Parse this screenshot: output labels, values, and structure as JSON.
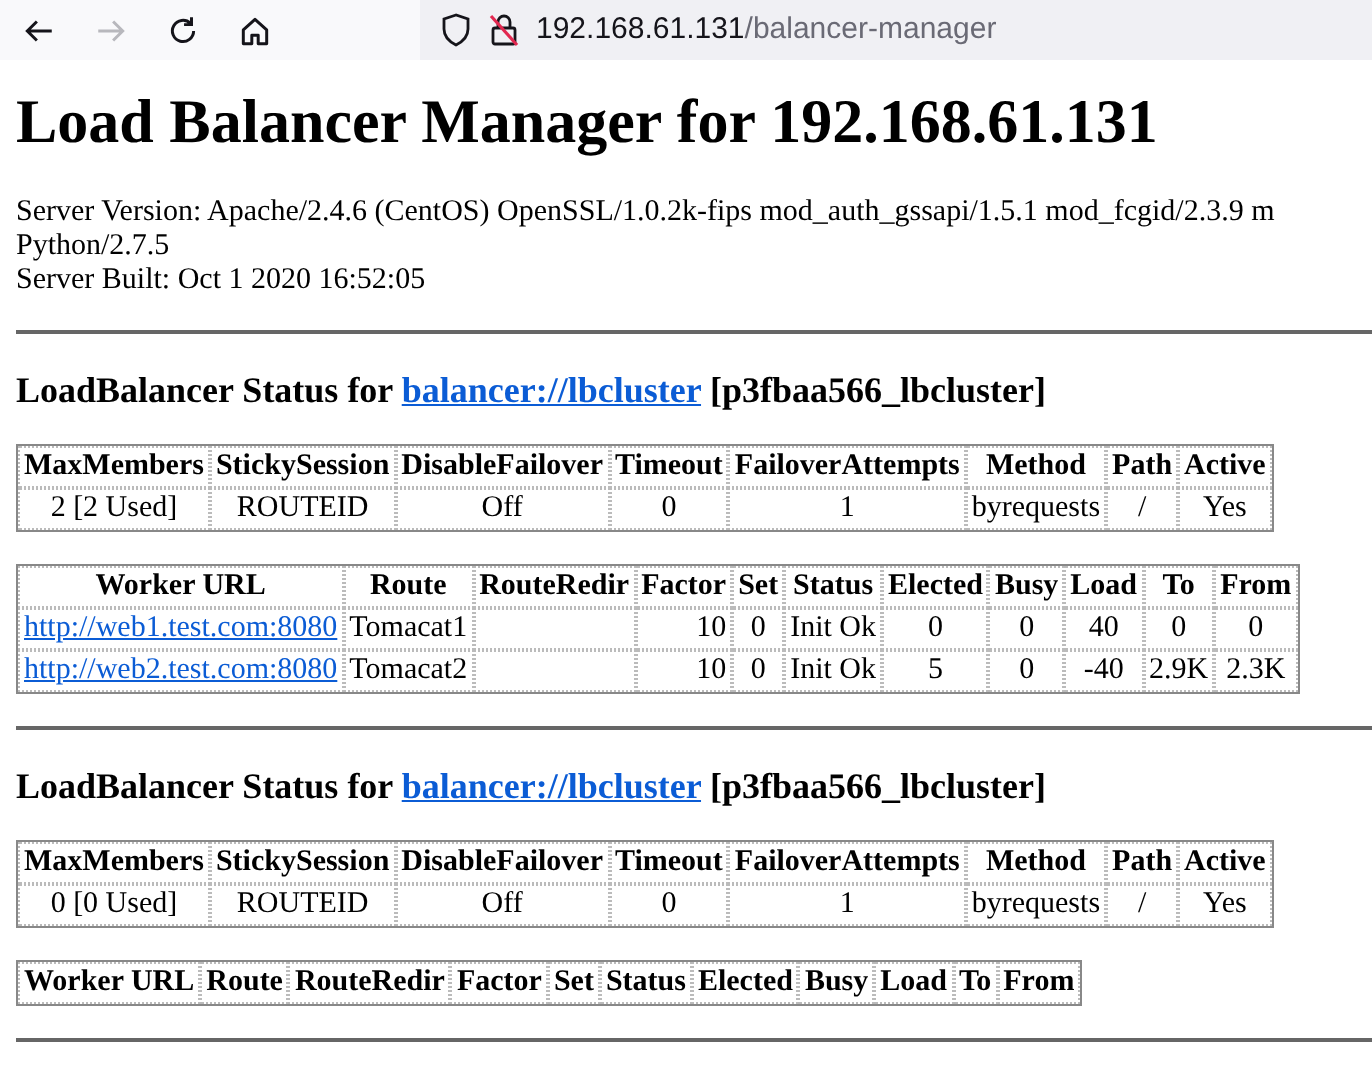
{
  "browser": {
    "forward_disabled": true,
    "url_host": "192.168.61.131",
    "url_path": "/balancer-manager",
    "insecure": true
  },
  "heading": "Load Balancer Manager for 192.168.61.131",
  "server_info": [
    "Server Version: Apache/2.4.6 (CentOS) OpenSSL/1.0.2k-fips mod_auth_gssapi/1.5.1 mod_fcgid/2.3.9 m",
    "Python/2.7.5",
    "Server Built: Oct 1 2020 16:52:05"
  ],
  "sections": [
    {
      "title": "LoadBalancer Status for",
      "link": "balancer://lbcluster",
      "name": "[p3fbaa566_lbcluster]",
      "params": {
        "columns": [
          "MaxMembers",
          "StickySession",
          "DisableFailover",
          "Timeout",
          "FailoverAttempts",
          "Method",
          "Path",
          "Active"
        ],
        "rows": [
          [
            "2 [2 Used]",
            "ROUTEID",
            "Off",
            "0",
            "1",
            "byrequests",
            "/",
            "Yes"
          ]
        ]
      },
      "workers": {
        "columns": [
          "Worker URL",
          "Route",
          "RouteRedir",
          "Factor",
          "Set",
          "Status",
          "Elected",
          "Busy",
          "Load",
          "To",
          "From"
        ],
        "rows": [
          [
            "http://web1.test.com:8080",
            "Tomacat1",
            "",
            "10",
            "0",
            "Init Ok",
            "0",
            "0",
            "40",
            "0",
            "0"
          ],
          [
            "http://web2.test.com:8080",
            "Tomacat2",
            "",
            "10",
            "0",
            "Init Ok",
            "5",
            "0",
            "-40",
            "2.9K",
            "2.3K"
          ]
        ]
      }
    },
    {
      "title": "LoadBalancer Status for",
      "link": "balancer://lbcluster",
      "name": "[p3fbaa566_lbcluster]",
      "params": {
        "columns": [
          "MaxMembers",
          "StickySession",
          "DisableFailover",
          "Timeout",
          "FailoverAttempts",
          "Method",
          "Path",
          "Active"
        ],
        "rows": [
          [
            "0 [0 Used]",
            "ROUTEID",
            "Off",
            "0",
            "1",
            "byrequests",
            "/",
            "Yes"
          ]
        ]
      },
      "workers": {
        "columns": [
          "Worker URL",
          "Route",
          "RouteRedir",
          "Factor",
          "Set",
          "Status",
          "Elected",
          "Busy",
          "Load",
          "To",
          "From"
        ]
      }
    }
  ]
}
